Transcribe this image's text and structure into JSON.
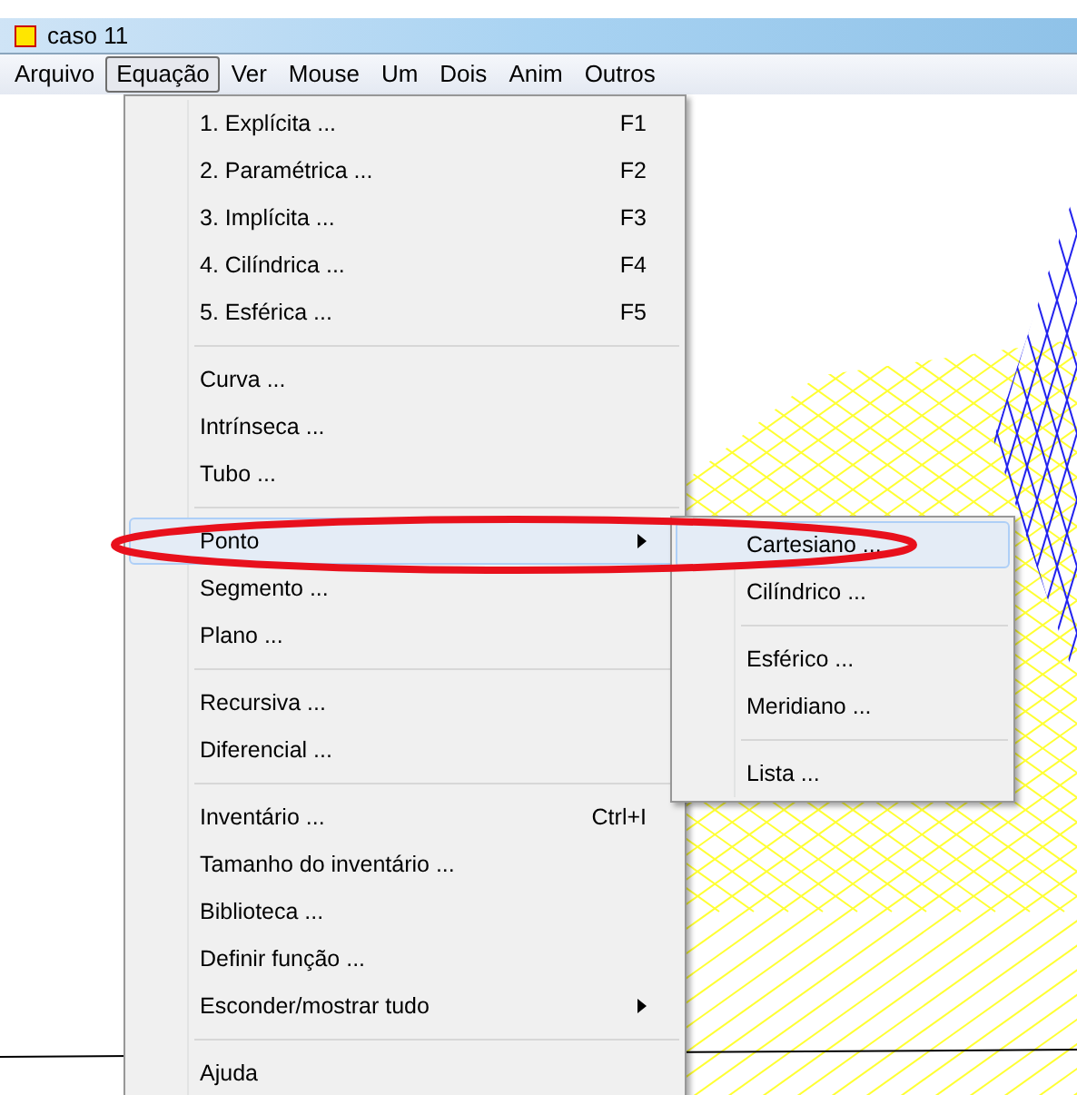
{
  "window": {
    "title": "caso 11"
  },
  "menubar": [
    {
      "label": "Arquivo",
      "selected": false
    },
    {
      "label": "Equação",
      "selected": true
    },
    {
      "label": "Ver",
      "selected": false
    },
    {
      "label": "Mouse",
      "selected": false
    },
    {
      "label": "Um",
      "selected": false
    },
    {
      "label": "Dois",
      "selected": false
    },
    {
      "label": "Anim",
      "selected": false
    },
    {
      "label": "Outros",
      "selected": false
    }
  ],
  "menu": [
    {
      "kind": "item",
      "label": "1. Explícita ...",
      "shortcut": "F1",
      "submenu": false,
      "selected": false
    },
    {
      "kind": "item",
      "label": "2. Paramétrica ...",
      "shortcut": "F2",
      "submenu": false,
      "selected": false
    },
    {
      "kind": "item",
      "label": "3. Implícita ...",
      "shortcut": "F3",
      "submenu": false,
      "selected": false
    },
    {
      "kind": "item",
      "label": "4. Cilíndrica ...",
      "shortcut": "F4",
      "submenu": false,
      "selected": false
    },
    {
      "kind": "item",
      "label": "5. Esférica ...",
      "shortcut": "F5",
      "submenu": false,
      "selected": false
    },
    {
      "kind": "separator"
    },
    {
      "kind": "item",
      "label": "Curva ...",
      "submenu": false,
      "selected": false
    },
    {
      "kind": "item",
      "label": "Intrínseca ...",
      "submenu": false,
      "selected": false
    },
    {
      "kind": "item",
      "label": "Tubo ...",
      "submenu": false,
      "selected": false
    },
    {
      "kind": "separator"
    },
    {
      "kind": "item",
      "label": "Ponto",
      "submenu": true,
      "selected": true
    },
    {
      "kind": "item",
      "label": "Segmento ...",
      "submenu": false,
      "selected": false
    },
    {
      "kind": "item",
      "label": "Plano ...",
      "submenu": false,
      "selected": false
    },
    {
      "kind": "separator"
    },
    {
      "kind": "item",
      "label": "Recursiva ...",
      "submenu": false,
      "selected": false
    },
    {
      "kind": "item",
      "label": "Diferencial ...",
      "submenu": false,
      "selected": false
    },
    {
      "kind": "separator"
    },
    {
      "kind": "item",
      "label": "Inventário ...",
      "shortcut": "Ctrl+I",
      "submenu": false,
      "selected": false
    },
    {
      "kind": "item",
      "label": "Tamanho do inventário ...",
      "submenu": false,
      "selected": false
    },
    {
      "kind": "item",
      "label": "Biblioteca ...",
      "submenu": false,
      "selected": false
    },
    {
      "kind": "item",
      "label": "Definir função ...",
      "submenu": false,
      "selected": false
    },
    {
      "kind": "item",
      "label": "Esconder/mostrar tudo",
      "submenu": true,
      "selected": false
    },
    {
      "kind": "separator"
    },
    {
      "kind": "item",
      "label": "Ajuda",
      "submenu": false,
      "selected": false
    }
  ],
  "submenu": [
    {
      "kind": "item",
      "label": "Cartesiano ...",
      "selected": true
    },
    {
      "kind": "item",
      "label": "Cilíndrico ...",
      "selected": false
    },
    {
      "kind": "separator"
    },
    {
      "kind": "item",
      "label": "Esférico ...",
      "selected": false
    },
    {
      "kind": "item",
      "label": "Meridiano ...",
      "selected": false
    },
    {
      "kind": "separator"
    },
    {
      "kind": "item",
      "label": "Lista ...",
      "selected": false
    }
  ]
}
